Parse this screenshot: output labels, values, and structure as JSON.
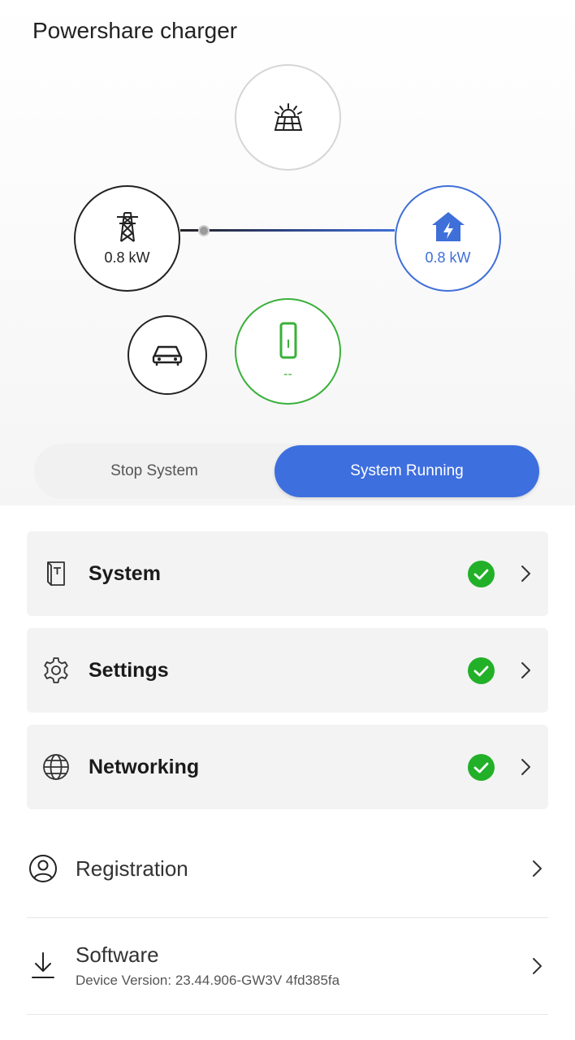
{
  "page": {
    "title": "Powershare charger"
  },
  "flow": {
    "grid": {
      "power": "0.8 kW"
    },
    "home": {
      "power": "0.8 kW"
    },
    "charger": {
      "power": "--"
    }
  },
  "toggle": {
    "stop_label": "Stop System",
    "running_label": "System Running",
    "active": "running"
  },
  "cards": [
    {
      "label": "System",
      "icon": "powershare-device-icon",
      "status": "ok"
    },
    {
      "label": "Settings",
      "icon": "gear-icon",
      "status": "ok"
    },
    {
      "label": "Networking",
      "icon": "globe-icon",
      "status": "ok"
    }
  ],
  "rows": {
    "registration": {
      "label": "Registration",
      "icon": "user-circle-icon"
    },
    "software": {
      "label": "Software",
      "sub": "Device Version: 23.44.906-GW3V 4fd385fa",
      "icon": "download-icon"
    }
  },
  "colors": {
    "accent": "#3e6fdf",
    "status_ok": "#22b028",
    "charger": "#3ab03a"
  }
}
